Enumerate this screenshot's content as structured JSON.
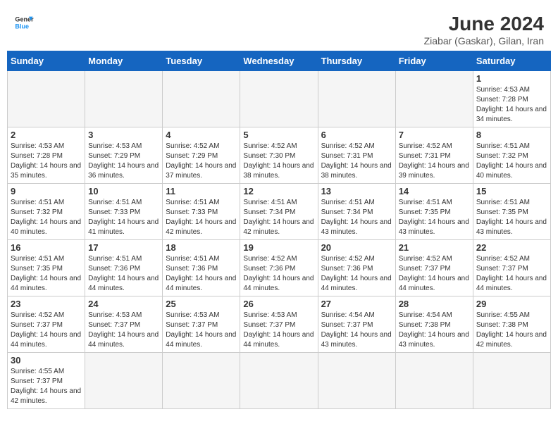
{
  "logo": {
    "text_general": "General",
    "text_blue": "Blue"
  },
  "header": {
    "title": "June 2024",
    "subtitle": "Ziabar (Gaskar), Gilan, Iran"
  },
  "weekdays": [
    "Sunday",
    "Monday",
    "Tuesday",
    "Wednesday",
    "Thursday",
    "Friday",
    "Saturday"
  ],
  "days": [
    {
      "date": 1,
      "sunrise": "4:53 AM",
      "sunset": "7:28 PM",
      "daylight_hours": 14,
      "daylight_minutes": 34
    },
    {
      "date": 2,
      "sunrise": "4:53 AM",
      "sunset": "7:28 PM",
      "daylight_hours": 14,
      "daylight_minutes": 35
    },
    {
      "date": 3,
      "sunrise": "4:53 AM",
      "sunset": "7:29 PM",
      "daylight_hours": 14,
      "daylight_minutes": 36
    },
    {
      "date": 4,
      "sunrise": "4:52 AM",
      "sunset": "7:29 PM",
      "daylight_hours": 14,
      "daylight_minutes": 37
    },
    {
      "date": 5,
      "sunrise": "4:52 AM",
      "sunset": "7:30 PM",
      "daylight_hours": 14,
      "daylight_minutes": 38
    },
    {
      "date": 6,
      "sunrise": "4:52 AM",
      "sunset": "7:31 PM",
      "daylight_hours": 14,
      "daylight_minutes": 38
    },
    {
      "date": 7,
      "sunrise": "4:52 AM",
      "sunset": "7:31 PM",
      "daylight_hours": 14,
      "daylight_minutes": 39
    },
    {
      "date": 8,
      "sunrise": "4:51 AM",
      "sunset": "7:32 PM",
      "daylight_hours": 14,
      "daylight_minutes": 40
    },
    {
      "date": 9,
      "sunrise": "4:51 AM",
      "sunset": "7:32 PM",
      "daylight_hours": 14,
      "daylight_minutes": 40
    },
    {
      "date": 10,
      "sunrise": "4:51 AM",
      "sunset": "7:33 PM",
      "daylight_hours": 14,
      "daylight_minutes": 41
    },
    {
      "date": 11,
      "sunrise": "4:51 AM",
      "sunset": "7:33 PM",
      "daylight_hours": 14,
      "daylight_minutes": 42
    },
    {
      "date": 12,
      "sunrise": "4:51 AM",
      "sunset": "7:34 PM",
      "daylight_hours": 14,
      "daylight_minutes": 42
    },
    {
      "date": 13,
      "sunrise": "4:51 AM",
      "sunset": "7:34 PM",
      "daylight_hours": 14,
      "daylight_minutes": 43
    },
    {
      "date": 14,
      "sunrise": "4:51 AM",
      "sunset": "7:35 PM",
      "daylight_hours": 14,
      "daylight_minutes": 43
    },
    {
      "date": 15,
      "sunrise": "4:51 AM",
      "sunset": "7:35 PM",
      "daylight_hours": 14,
      "daylight_minutes": 43
    },
    {
      "date": 16,
      "sunrise": "4:51 AM",
      "sunset": "7:35 PM",
      "daylight_hours": 14,
      "daylight_minutes": 44
    },
    {
      "date": 17,
      "sunrise": "4:51 AM",
      "sunset": "7:36 PM",
      "daylight_hours": 14,
      "daylight_minutes": 44
    },
    {
      "date": 18,
      "sunrise": "4:51 AM",
      "sunset": "7:36 PM",
      "daylight_hours": 14,
      "daylight_minutes": 44
    },
    {
      "date": 19,
      "sunrise": "4:52 AM",
      "sunset": "7:36 PM",
      "daylight_hours": 14,
      "daylight_minutes": 44
    },
    {
      "date": 20,
      "sunrise": "4:52 AM",
      "sunset": "7:36 PM",
      "daylight_hours": 14,
      "daylight_minutes": 44
    },
    {
      "date": 21,
      "sunrise": "4:52 AM",
      "sunset": "7:37 PM",
      "daylight_hours": 14,
      "daylight_minutes": 44
    },
    {
      "date": 22,
      "sunrise": "4:52 AM",
      "sunset": "7:37 PM",
      "daylight_hours": 14,
      "daylight_minutes": 44
    },
    {
      "date": 23,
      "sunrise": "4:52 AM",
      "sunset": "7:37 PM",
      "daylight_hours": 14,
      "daylight_minutes": 44
    },
    {
      "date": 24,
      "sunrise": "4:53 AM",
      "sunset": "7:37 PM",
      "daylight_hours": 14,
      "daylight_minutes": 44
    },
    {
      "date": 25,
      "sunrise": "4:53 AM",
      "sunset": "7:37 PM",
      "daylight_hours": 14,
      "daylight_minutes": 44
    },
    {
      "date": 26,
      "sunrise": "4:53 AM",
      "sunset": "7:37 PM",
      "daylight_hours": 14,
      "daylight_minutes": 44
    },
    {
      "date": 27,
      "sunrise": "4:54 AM",
      "sunset": "7:37 PM",
      "daylight_hours": 14,
      "daylight_minutes": 43
    },
    {
      "date": 28,
      "sunrise": "4:54 AM",
      "sunset": "7:38 PM",
      "daylight_hours": 14,
      "daylight_minutes": 43
    },
    {
      "date": 29,
      "sunrise": "4:55 AM",
      "sunset": "7:38 PM",
      "daylight_hours": 14,
      "daylight_minutes": 42
    },
    {
      "date": 30,
      "sunrise": "4:55 AM",
      "sunset": "7:37 PM",
      "daylight_hours": 14,
      "daylight_minutes": 42
    }
  ]
}
